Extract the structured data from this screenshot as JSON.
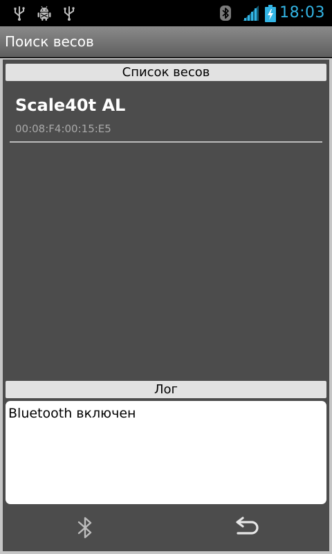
{
  "status_bar": {
    "time": "18:03",
    "left_icons": [
      "usb-icon",
      "android-debug-icon",
      "usb-icon"
    ],
    "right_icons": [
      "bluetooth-icon",
      "signal-icon",
      "battery-charging-icon"
    ],
    "time_color": "#33b5e5"
  },
  "title_bar": {
    "title": "Поиск весов"
  },
  "scale_list": {
    "header": "Список весов",
    "items": [
      {
        "name": "Scale40t AL",
        "address": "00:08:F4:00:15:E5"
      }
    ]
  },
  "log": {
    "header": "Лог",
    "text": "Bluetooth включен"
  },
  "bottom_bar": {
    "buttons": [
      "bluetooth-icon",
      "back-icon"
    ]
  },
  "colors": {
    "panel_bg": "#4c4c4c",
    "header_bg": "#e2e2e2",
    "accent": "#33b5e5"
  }
}
